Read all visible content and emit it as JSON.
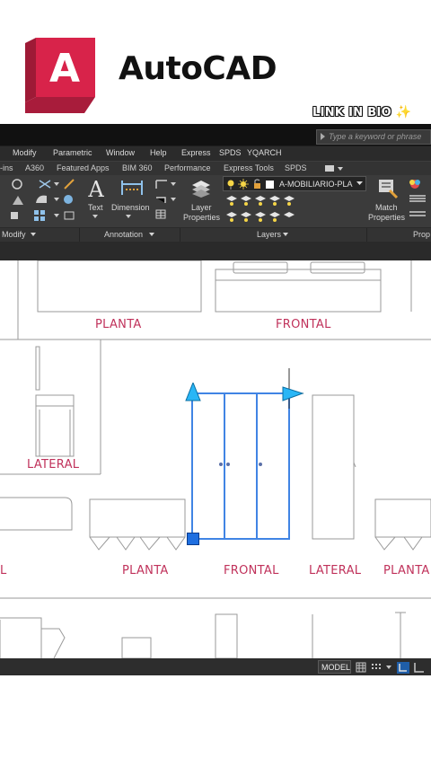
{
  "header": {
    "app_title": "AutoCAD",
    "logo_letter": "A",
    "link_in_bio": "LINK IN BIO",
    "sparkle": "✨"
  },
  "titlebar": {
    "search_placeholder": "Type a keyword or phrase"
  },
  "menubar": {
    "items": [
      "Modify",
      "Parametric",
      "Window",
      "Help",
      "Express",
      "SPDS",
      "YQARCH"
    ]
  },
  "ribbon_tabs": {
    "items": [
      "-ins",
      "A360",
      "Featured Apps",
      "BIM 360",
      "Performance",
      "Express Tools",
      "SPDS"
    ]
  },
  "ribbon": {
    "text_label": "Text",
    "dimension_label": "Dimension",
    "layer_properties_line1": "Layer",
    "layer_properties_line2": "Properties",
    "match_properties_line1": "Match",
    "match_properties_line2": "Properties",
    "layer_current": "A-MOBILIARIO-PLA",
    "panels": {
      "modify": "Modify",
      "annotation": "Annotation",
      "layers": "Layers",
      "properties": "Prop"
    }
  },
  "drawing": {
    "labels": {
      "planta_top": "PLANTA",
      "frontal_top": "FRONTAL",
      "lateral_left": "LATERAL",
      "l_partial": "L",
      "planta_mid": "PLANTA",
      "frontal_mid": "FRONTAL",
      "lateral_mid": "LATERAL",
      "planta_right": "PLANTA"
    },
    "colors": {
      "label": "#c0325b",
      "selection": "#1f6fe0",
      "grip": "#29b6f6"
    }
  },
  "statusbar": {
    "model_label": "MODEL"
  }
}
